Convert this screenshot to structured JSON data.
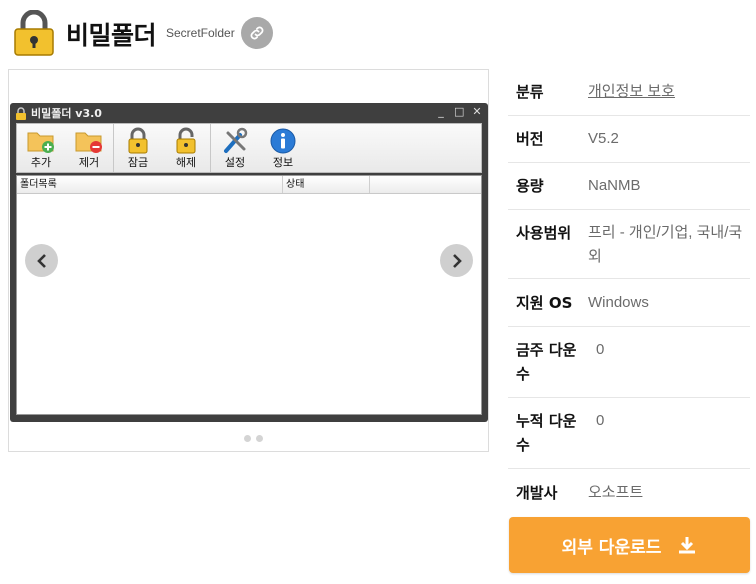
{
  "header": {
    "title": "비밀폴더",
    "subtitle": "SecretFolder",
    "link_icon": "link-icon",
    "logo_icon": "padlock-icon"
  },
  "screenshot": {
    "window_title": "비밀폴더 v3.0",
    "window_controls": [
      "_",
      "□",
      "✕"
    ],
    "toolbar": [
      {
        "label": "추가",
        "icon": "add-folder-icon"
      },
      {
        "label": "제거",
        "icon": "remove-folder-icon"
      },
      {
        "label": "잠금",
        "icon": "lock-icon"
      },
      {
        "label": "해제",
        "icon": "unlock-icon"
      },
      {
        "label": "설정",
        "icon": "tools-icon"
      },
      {
        "label": "정보",
        "icon": "info-icon"
      }
    ],
    "columns": [
      "폴더목록",
      "상태",
      ""
    ],
    "prev_icon": "chevron-left-icon",
    "next_icon": "chevron-right-icon"
  },
  "info": {
    "rows": [
      {
        "key": "분류",
        "value": "개인정보 보호",
        "link": true
      },
      {
        "key": "버전",
        "value": "V5.2"
      },
      {
        "key": "용량",
        "value": "NaNMB"
      },
      {
        "key": "사용범위",
        "value": "프리 - 개인/기업, 국내/국외"
      },
      {
        "key": "지원 OS",
        "value": "Windows"
      },
      {
        "key": "금주 다운수",
        "value": "0"
      },
      {
        "key": "누적 다운수",
        "value": "0"
      },
      {
        "key": "개발사",
        "value": "오소프트"
      }
    ]
  },
  "download": {
    "label": "외부 다운로드",
    "icon": "download-icon",
    "color": "#F8A233"
  }
}
